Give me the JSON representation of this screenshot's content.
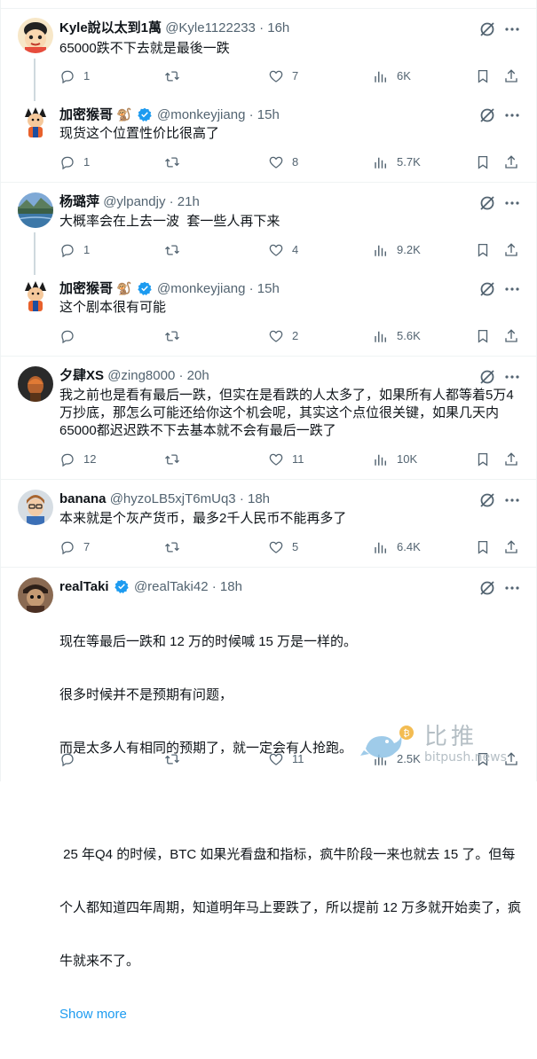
{
  "tweets": [
    {
      "name": "Kyle說以太到1萬",
      "handle": "@Kyle1122233",
      "time": "16h",
      "text": [
        "65000跌不下去就是最後一跌"
      ],
      "replies": "1",
      "retweets": "",
      "likes": "7",
      "views": "6K"
    },
    {
      "name": "加密猴哥",
      "handle": "@monkeyjiang",
      "time": "15h",
      "text": [
        "现货这个位置性价比很高了"
      ],
      "replies": "1",
      "retweets": "",
      "likes": "8",
      "views": "5.7K"
    },
    {
      "name": "杨璐萍",
      "handle": "@ylpandjy",
      "time": "21h",
      "text": [
        "大概率会在上去一波  套一些人再下来"
      ],
      "replies": "1",
      "retweets": "",
      "likes": "4",
      "views": "9.2K"
    },
    {
      "name": "加密猴哥",
      "handle": "@monkeyjiang",
      "time": "15h",
      "text": [
        "这个剧本很有可能"
      ],
      "replies": "",
      "retweets": "",
      "likes": "2",
      "views": "5.6K"
    },
    {
      "name": "夕肆XS",
      "handle": "@zing8000",
      "time": "20h",
      "text": [
        "我之前也是看有最后一跌，但实在是看跌的人太多了，如果所有人都等着5万4",
        "万抄底，那怎么可能还给你这个机会呢，其实这个点位很关键，如果几天内",
        "65000都迟迟跌不下去基本就不会有最后一跌了"
      ],
      "replies": "12",
      "retweets": "",
      "likes": "11",
      "views": "10K"
    },
    {
      "name": "banana",
      "handle": "@hyzoLB5xjT6mUq3",
      "time": "18h",
      "text": [
        "本来就是个灰产货币，最多2千人民币不能再多了"
      ],
      "replies": "7",
      "retweets": "",
      "likes": "5",
      "views": "6.4K"
    },
    {
      "name": "realTaki",
      "handle": "@realTaki42",
      "time": "18h",
      "text": [
        "现在等最后一跌和 12 万的时候喊 15 万是一样的。",
        "很多时候并不是预期有问题，",
        "而是太多人有相同的预期了，就一定会有人抢跑。",
        "",
        " 25 年Q4 的时候，BTC 如果光看盘和指标，疯牛阶段一来也就去 15 了。但每",
        "个人都知道四年周期，知道明年马上要跌了，所以提前 12 万多就开始卖了，疯",
        "牛就来不了。"
      ],
      "show_more": "Show more",
      "replies": "",
      "retweets": "",
      "likes": "11",
      "views": "2.5K"
    }
  ],
  "monkey_emoji": "🐒",
  "dot": "·",
  "watermark": {
    "cn": "比推",
    "en": "bitpush.news"
  },
  "colors": {
    "verified": "#1d9bf0",
    "text_secondary": "#536471",
    "link": "#1d9bf0"
  }
}
